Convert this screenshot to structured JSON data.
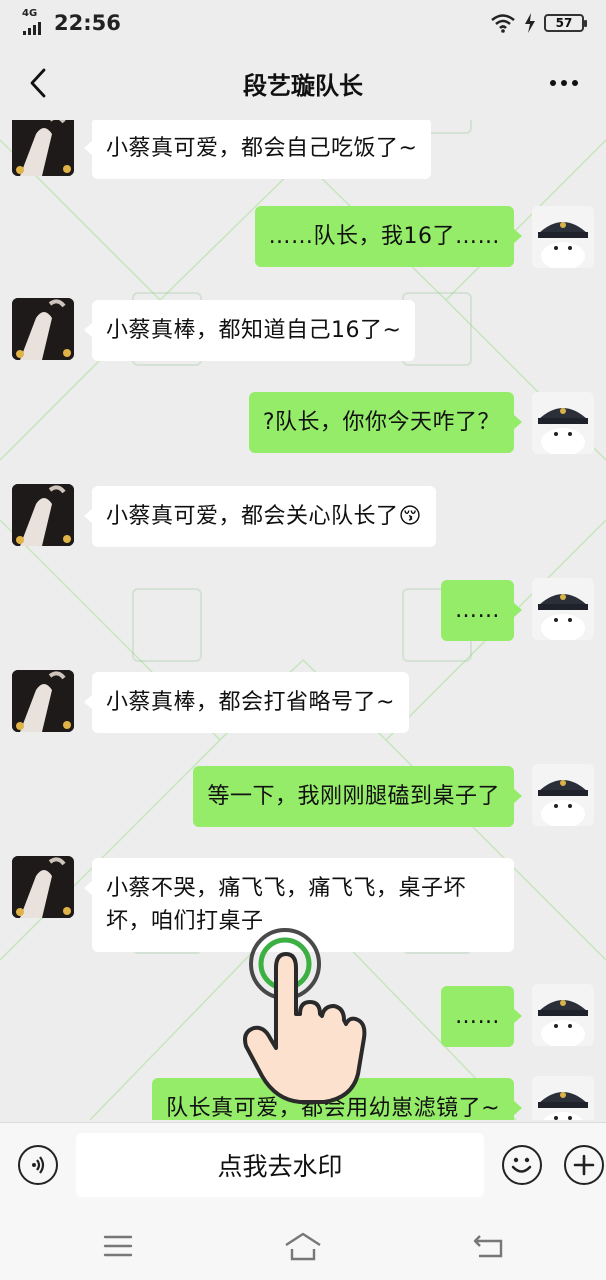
{
  "status": {
    "network": "4G",
    "time": "22:56",
    "battery": "57"
  },
  "header": {
    "title": "段艺璇队长"
  },
  "messages": [
    {
      "side": "left",
      "text": "小蔡真可爱，都会自己吃饭了~"
    },
    {
      "side": "right",
      "text": "……队长，我16了……"
    },
    {
      "side": "left",
      "text": "小蔡真棒，都知道自己16了~"
    },
    {
      "side": "right",
      "text": "?队长，你你今天咋了？"
    },
    {
      "side": "left",
      "text": "小蔡真可爱，都会关心队长了",
      "emoji": "😚"
    },
    {
      "side": "right",
      "text": "……"
    },
    {
      "side": "left",
      "text": "小蔡真棒，都会打省略号了~"
    },
    {
      "side": "right",
      "text": "等一下，我刚刚腿磕到桌子了"
    },
    {
      "side": "left",
      "text": "小蔡不哭，痛飞飞，痛飞飞，桌子坏坏，咱们打桌子"
    },
    {
      "side": "right",
      "text": "……"
    },
    {
      "side": "right",
      "text": "队长真可爱，都会用幼崽滤镜了~"
    }
  ],
  "input": {
    "value": "点我去水印"
  },
  "icons": {
    "back": "back-arrow-icon",
    "more": "more-dots-icon",
    "voice": "voice-icon",
    "emoji": "emoji-icon",
    "plus": "plus-icon",
    "menu": "menu-icon",
    "home": "home-icon",
    "return": "return-icon",
    "tap": "tap-hand-icon"
  },
  "colors": {
    "self_bubble": "#95ec69",
    "other_bubble": "#ffffff",
    "background": "#ededed"
  }
}
